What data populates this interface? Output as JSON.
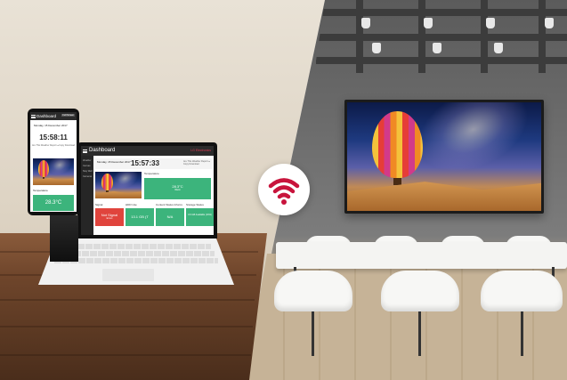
{
  "colors": {
    "accent_red": "#c8143c",
    "tile_green": "#3cb47c",
    "tile_red": "#e0443d",
    "dashboard_dark": "#2b2b2b"
  },
  "wifi": {
    "icon": "wifi-icon"
  },
  "phone": {
    "title": "Dashboard",
    "button": "Full Screen",
    "date": "Monday, 15 December 2017",
    "time": "15:58:11",
    "note": "Are This Weather Report ● Copy Download",
    "temperature_label": "Temperature",
    "temperature_value": "28.3°C"
  },
  "laptop": {
    "title": "Dashboard",
    "brand": "LG Electronics",
    "date": "Monday, 15 December 2017",
    "time": "15:57:33",
    "note": "Are This Weather Report ● Copy Download",
    "side_items": [
      "Weather",
      "Canvas",
      "Stay Well",
      "Cameras"
    ],
    "temperature_label": "Temperature",
    "temperature_value": "28.3°C",
    "temperature_sub": "Warm",
    "tiles": [
      {
        "label": "Signal",
        "value": "Not Signal",
        "sub": "Errors",
        "color": "#e0443d"
      },
      {
        "label": "HDD Use",
        "value": "13.1 GB (T",
        "sub": "",
        "color": "#3cb47c"
      },
      {
        "label": "Content Status Information",
        "value": "N/A",
        "sub": "",
        "color": "#3cb47c"
      },
      {
        "label": "Storage Status",
        "value": "3.6 GB Available (16%)",
        "sub": "",
        "color": "#3cb47c"
      }
    ]
  }
}
